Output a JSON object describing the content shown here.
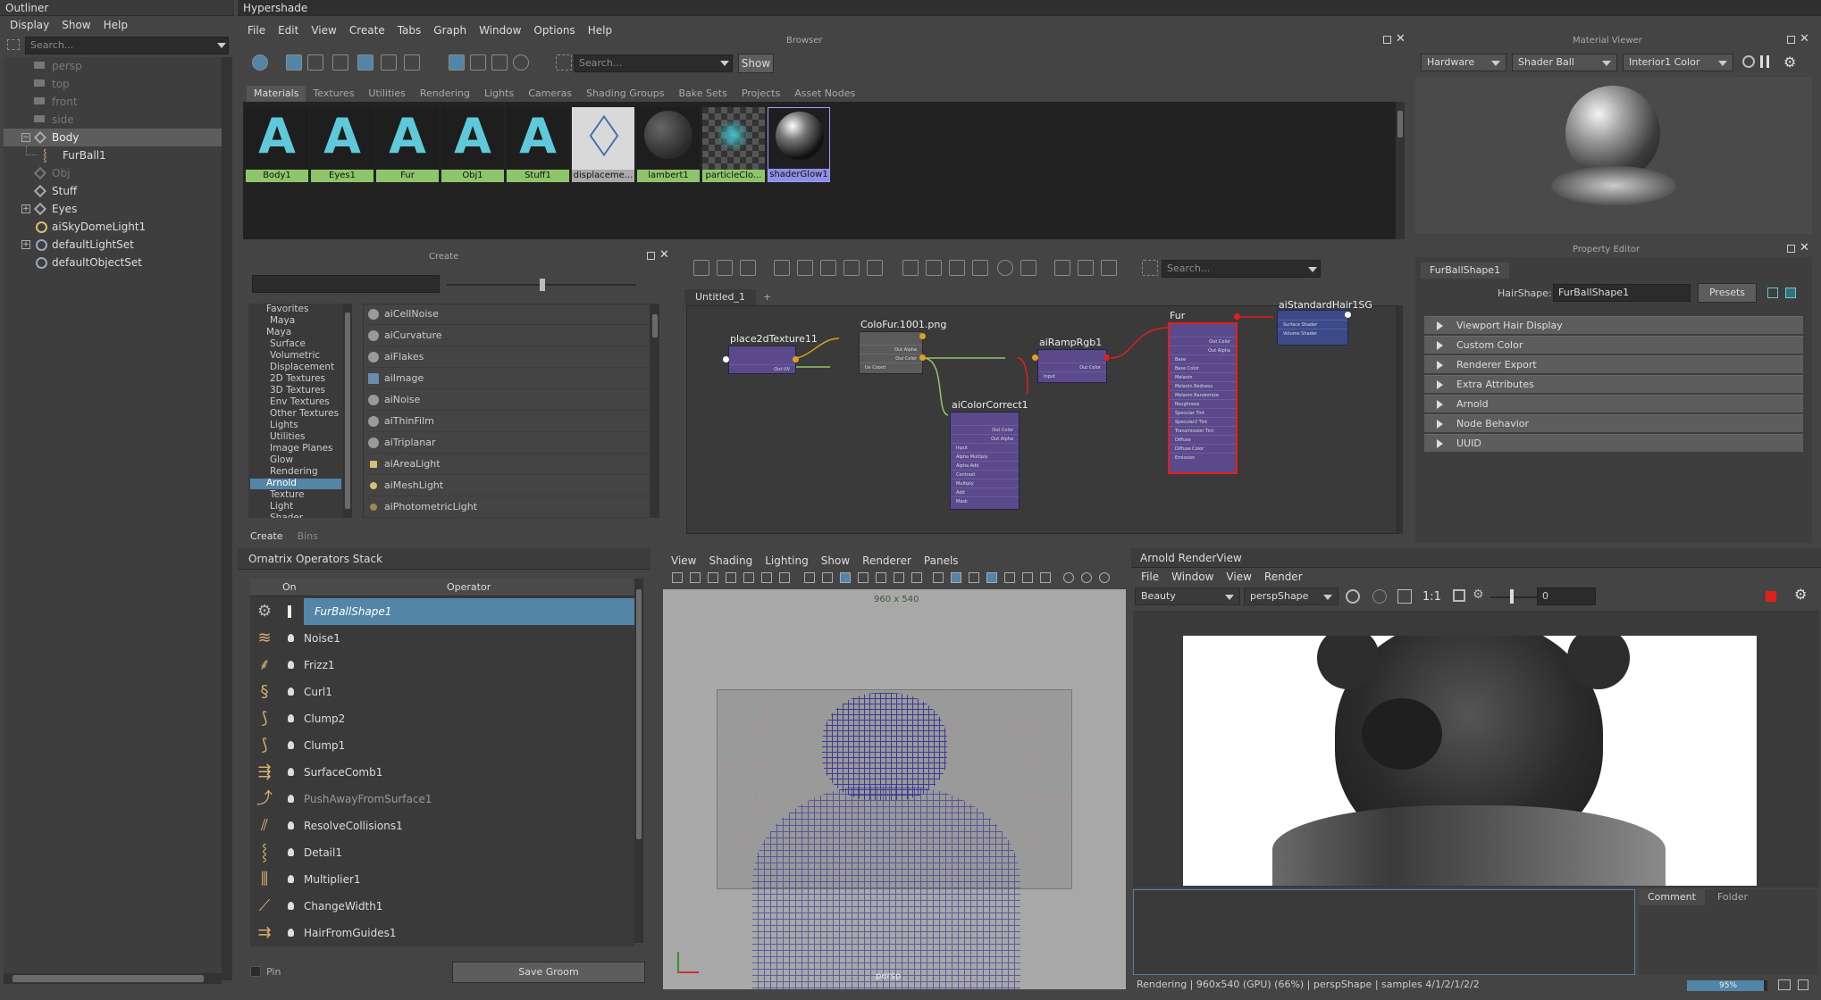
{
  "outliner": {
    "title": "Outliner",
    "menu": [
      "Display",
      "Show",
      "Help"
    ],
    "search_placeholder": "Search...",
    "items": [
      {
        "label": "persp",
        "dim": true
      },
      {
        "label": "top",
        "dim": true
      },
      {
        "label": "front",
        "dim": true
      },
      {
        "label": "side",
        "dim": true
      },
      {
        "label": "Body",
        "dim": false
      },
      {
        "label": "FurBall1",
        "dim": false
      },
      {
        "label": "Obj",
        "dim": true
      },
      {
        "label": "Stuff",
        "dim": false
      },
      {
        "label": "Eyes",
        "dim": false
      },
      {
        "label": "aiSkyDomeLight1",
        "dim": false
      },
      {
        "label": "defaultLightSet",
        "dim": false
      },
      {
        "label": "defaultObjectSet",
        "dim": false
      }
    ]
  },
  "hypershade": {
    "title": "Hypershade",
    "menu": [
      "File",
      "Edit",
      "View",
      "Create",
      "Tabs",
      "Graph",
      "Window",
      "Options",
      "Help"
    ],
    "browser": {
      "title": "Browser",
      "search_placeholder": "Search...",
      "show_button": "Show",
      "tabs": [
        "Materials",
        "Textures",
        "Utilities",
        "Rendering",
        "Lights",
        "Cameras",
        "Shading Groups",
        "Bake Sets",
        "Projects",
        "Asset Nodes"
      ],
      "materials": [
        "Body1",
        "Eyes1",
        "Fur",
        "Obj1",
        "Stuff1",
        "displaceme...",
        "lambert1",
        "particleClo...",
        "shaderGlow1"
      ]
    },
    "material_viewer": {
      "title": "Material Viewer",
      "renderer": "Hardware",
      "shape": "Shader Ball",
      "environment": "Interior1 Color"
    },
    "create": {
      "title": "Create",
      "tree": [
        "Favorites",
        "Maya",
        "Maya",
        "Surface",
        "Volumetric",
        "Displacement",
        "2D Textures",
        "3D Textures",
        "Env Textures",
        "Other Textures",
        "Lights",
        "Utilities",
        "Image Planes",
        "Glow",
        "Rendering",
        "Arnold",
        "Texture",
        "Light",
        "Shader"
      ],
      "items": [
        "aiCellNoise",
        "aiCurvature",
        "aiFlakes",
        "aiImage",
        "aiNoise",
        "aiThinFilm",
        "aiTriplanar",
        "aiAreaLight",
        "aiMeshLight",
        "aiPhotometricLight"
      ],
      "bottom_tabs": [
        "Create",
        "Bins"
      ]
    },
    "graph": {
      "search_placeholder": "Search...",
      "tab": "Untitled_1",
      "add_tab": "+",
      "nodes": {
        "place2d": "place2dTexture11",
        "file": "ColoFur.1001.png",
        "ramp": "aiRampRgb1",
        "correct": "aiColorCorrect1",
        "fur": "Fur",
        "sg": "aiStandardHair1SG"
      }
    },
    "property_editor": {
      "title": "Property Editor",
      "tab": "FurBallShape1",
      "field_label": "HairShape:",
      "field_value": "FurBallShape1",
      "presets": "Presets",
      "sections": [
        "Viewport Hair Display",
        "Custom Color",
        "Renderer Export",
        "Extra Attributes",
        "Arnold",
        "Node Behavior",
        "UUID"
      ]
    }
  },
  "ornatrix": {
    "title": "Ornatrix Operators Stack",
    "col_on": "On",
    "col_operator": "Operator",
    "operators": [
      "FurBallShape1",
      "Noise1",
      "Frizz1",
      "Curl1",
      "Clump2",
      "Clump1",
      "SurfaceComb1",
      "PushAwayFromSurface1",
      "ResolveCollisions1",
      "Detail1",
      "Multiplier1",
      "ChangeWidth1",
      "HairFromGuides1"
    ],
    "pin": "Pin",
    "save_groom": "Save Groom"
  },
  "viewport": {
    "menu": [
      "View",
      "Shading",
      "Lighting",
      "Show",
      "Renderer",
      "Panels"
    ],
    "resolution": "960 x 540",
    "camera": "persp"
  },
  "render_view": {
    "title": "Arnold RenderView",
    "menu": [
      "File",
      "Window",
      "View",
      "Render"
    ],
    "aov": "Beauty",
    "camera": "perspShape",
    "ratio": "1:1",
    "exposure": "0",
    "tabs": [
      "Comment",
      "Folder"
    ],
    "status": "Rendering | 960x540 (GPU) (66%) | perspShape | samples 4/1/2/1/2/2",
    "progress_label": "95%",
    "progress": 0.95
  },
  "colors": {
    "accent": "#5285a6",
    "material_label": "#8fc56a",
    "node": "#5a4a8c",
    "selected_node_border": "#e0201c"
  }
}
